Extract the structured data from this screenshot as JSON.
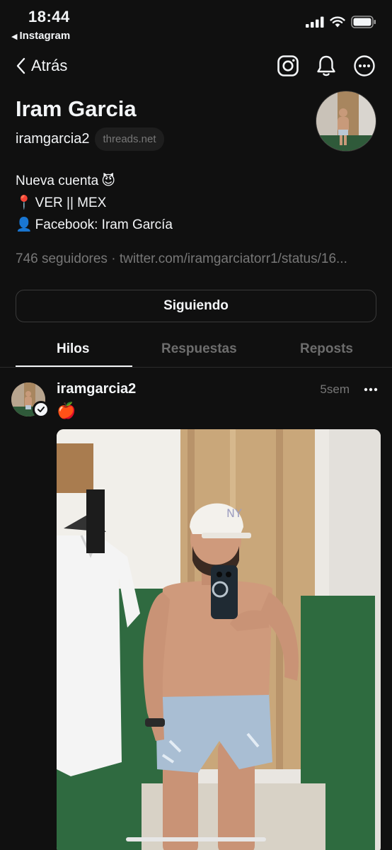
{
  "status_bar": {
    "time": "18:44",
    "back_app": "Instagram"
  },
  "nav": {
    "back_label": "Atrás",
    "icons": [
      "instagram-icon",
      "bell-icon",
      "more-circle-icon"
    ]
  },
  "profile": {
    "name": "Iram Garcia",
    "handle": "iramgarcia2",
    "domain_badge": "threads.net",
    "bio": [
      {
        "emoji": "😈",
        "text": "Nueva cuenta",
        "emoji_after": true
      },
      {
        "emoji": "📍",
        "text": "VER || MEX",
        "emoji_after": false
      },
      {
        "emoji": "👤",
        "text": "Facebook: Iram García",
        "emoji_after": false
      }
    ],
    "followers_line": "746 seguidores · twitter.com/iramgarciatorr1/status/16..."
  },
  "follow_button": "Siguiendo",
  "tabs": [
    {
      "label": "Hilos",
      "active": true
    },
    {
      "label": "Respuestas",
      "active": false
    },
    {
      "label": "Reposts",
      "active": false
    }
  ],
  "post": {
    "username": "iramgarcia2",
    "time": "5sem",
    "text": "🍎"
  }
}
